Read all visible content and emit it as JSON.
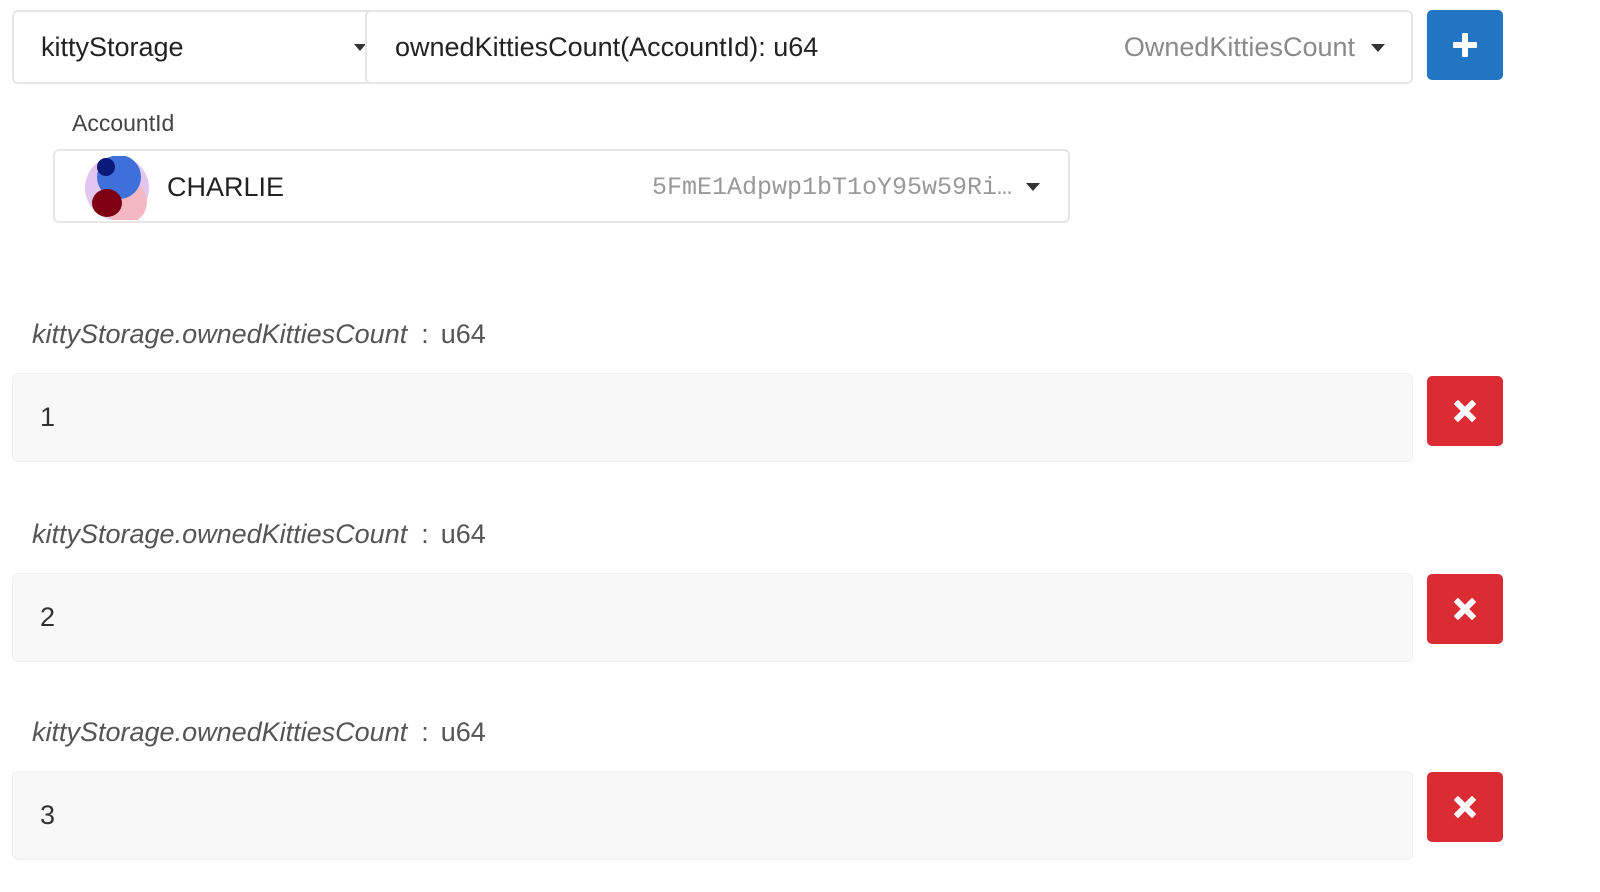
{
  "query": {
    "section": "kittyStorage",
    "method": "ownedKittiesCount(AccountId): u64",
    "method_hint": "OwnedKittiesCount",
    "add_icon": "plus-icon"
  },
  "param": {
    "label": "AccountId",
    "account_name": "CHARLIE",
    "account_address": "5FmE1Adpwp1bT1oY95w59Ri…",
    "identicon_colors": [
      "#e3c6f0",
      "#3f6fd8",
      "#0b1a7a",
      "#7c0012",
      "#f4b8c2"
    ]
  },
  "results": [
    {
      "key": "kittyStorage.ownedKittiesCount",
      "separator": ":",
      "type": "u64",
      "value": "1",
      "remove_icon": "close-icon"
    },
    {
      "key": "kittyStorage.ownedKittiesCount",
      "separator": ":",
      "type": "u64",
      "value": "2",
      "remove_icon": "close-icon"
    },
    {
      "key": "kittyStorage.ownedKittiesCount",
      "separator": ":",
      "type": "u64",
      "value": "3",
      "remove_icon": "close-icon"
    }
  ],
  "colors": {
    "add_button": "#2275c2",
    "remove_button": "#db2b33"
  }
}
